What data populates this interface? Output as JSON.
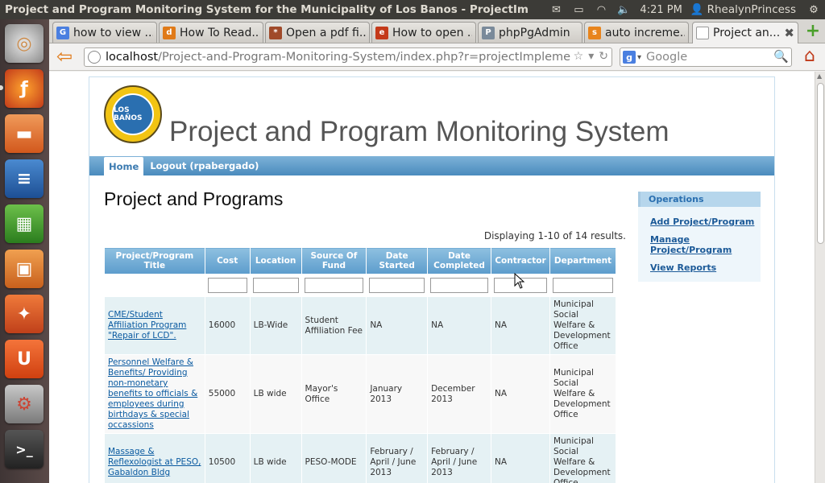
{
  "panel": {
    "window_title": "Project and Program Monitoring System for the Municipality of Los Banos - ProjectImplementor",
    "time": "4:21 PM",
    "user": "RhealynPrincess"
  },
  "launcher": {
    "items": [
      "ubuntu-dash",
      "firefox",
      "files",
      "libreoffice-writer",
      "libreoffice-calc",
      "libreoffice-impress",
      "software-center",
      "ubuntu-one",
      "system-settings",
      "terminal"
    ]
  },
  "tabs": [
    {
      "label": "how to view ...",
      "icon": "G"
    },
    {
      "label": "How To Read...",
      "icon": "d"
    },
    {
      "label": "Open a pdf fi...",
      "icon": "*"
    },
    {
      "label": "How to open ...",
      "icon": "e"
    },
    {
      "label": "phpPgAdmin",
      "icon": "P"
    },
    {
      "label": "auto increme...",
      "icon": "s"
    },
    {
      "label": "Project an...",
      "icon": ""
    }
  ],
  "urlbar": {
    "host": "localhost",
    "path": "/Project-and-Program-Monitoring-System/index.php?r=projectImplementor/"
  },
  "searchbar": {
    "placeholder": "Google"
  },
  "site": {
    "title": "Project and Program Monitoring System",
    "seal_text": "LOS BAÑOS"
  },
  "menu": {
    "home": "Home",
    "logout": "Logout (rpabergado)"
  },
  "main": {
    "heading": "Project and Programs",
    "summary": "Displaying 1-10 of 14 results."
  },
  "grid": {
    "columns": [
      "Project/Program Title",
      "Cost",
      "Location",
      "Source Of Fund",
      "Date Started",
      "Date Completed",
      "Contractor",
      "Department"
    ],
    "rows": [
      {
        "title": "CME/Student Affiliation Program \"Repair of LCD\".",
        "cost": "16000",
        "location": "LB-Wide",
        "source": "Student Affiliation Fee",
        "started": "NA",
        "completed": "NA",
        "contractor": "NA",
        "department": "Municipal Social Welfare & Development Office"
      },
      {
        "title": "Personnel Welfare & Benefits/ Providing non-monetary benefits to officials & employees during birthdays & special occassions",
        "cost": "55000",
        "location": "LB wide",
        "source": "Mayor's Office",
        "started": "January 2013",
        "completed": "December 2013",
        "contractor": "NA",
        "department": "Municipal Social Welfare & Development Office"
      },
      {
        "title": "Massage & Reflexologist at PESO, Gabaldon Bldg",
        "cost": "10500",
        "location": "LB wide",
        "source": "PESO-MODE",
        "started": "February / April / June 2013",
        "completed": "February / April / June 2013",
        "contractor": "NA",
        "department": "Municipal Social Welfare & Development Office"
      }
    ]
  },
  "sidebar": {
    "title": "Operations",
    "links": [
      "Add Project/Program",
      "Manage Project/Program",
      "View Reports"
    ]
  }
}
